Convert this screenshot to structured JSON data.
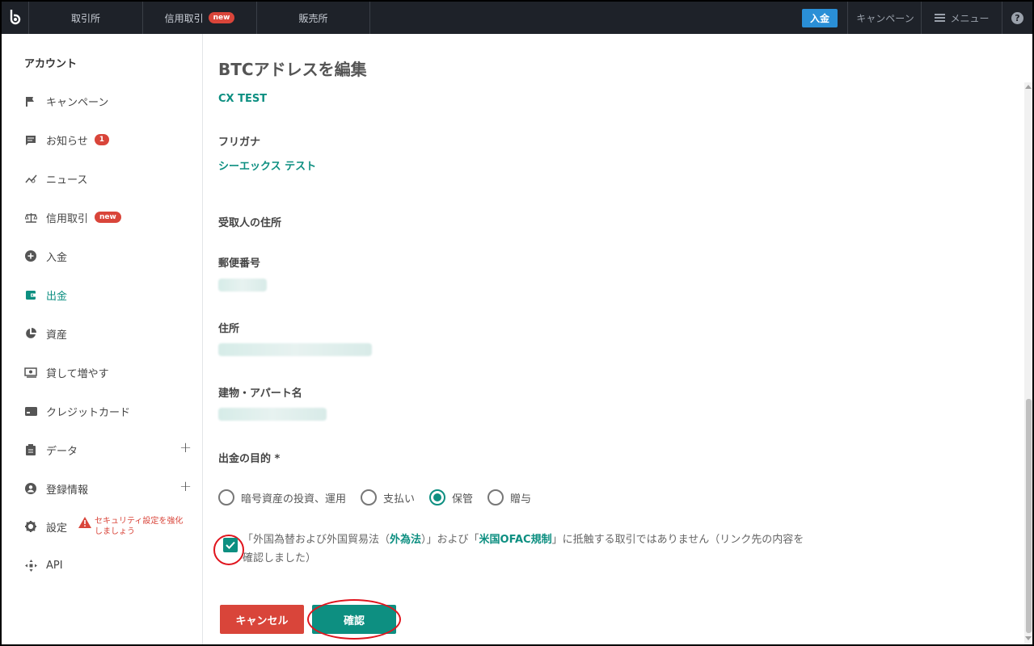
{
  "topbar": {
    "tabs": [
      {
        "label": "取引所"
      },
      {
        "label": "信用取引",
        "badge": "new"
      },
      {
        "label": "販売所"
      }
    ],
    "deposit_label": "入金",
    "campaign_label": "キャンペーン",
    "menu_label": "メニュー",
    "help_label": "?"
  },
  "sidebar": {
    "title": "アカウント",
    "items": [
      {
        "label": "キャンペーン",
        "icon": "flag-icon"
      },
      {
        "label": "お知らせ",
        "icon": "message-icon",
        "count": "1"
      },
      {
        "label": "ニュース",
        "icon": "chart-line-icon"
      },
      {
        "label": "信用取引",
        "icon": "scale-icon",
        "badge": "new"
      },
      {
        "label": "入金",
        "icon": "plus-circle-icon"
      },
      {
        "label": "出金",
        "icon": "wallet-icon",
        "active": true
      },
      {
        "label": "資産",
        "icon": "pie-chart-icon"
      },
      {
        "label": "貸して増やす",
        "icon": "money-icon"
      },
      {
        "label": "クレジットカード",
        "icon": "credit-card-icon"
      },
      {
        "label": "データ",
        "icon": "clipboard-icon"
      },
      {
        "label": "登録情報",
        "icon": "account-icon"
      },
      {
        "label": "設定",
        "icon": "gear-icon"
      },
      {
        "label": "API",
        "icon": "api-icon"
      }
    ],
    "security_warning": "セキュリティ設定を強化しましょう"
  },
  "main": {
    "title": "BTCアドレスを編集",
    "recipient_name": "CX TEST",
    "furigana_label": "フリガナ",
    "furigana_value": "シーエックス テスト",
    "address_section": "受取人の住所",
    "postal_label": "郵便番号",
    "address_label": "住所",
    "building_label": "建物・アパート名",
    "purpose_label": "出金の目的 *",
    "purpose_options": [
      "暗号資産の投資、運用",
      "支払い",
      "保管",
      "贈与"
    ],
    "purpose_selected": "保管",
    "agree_text_1": "「外国為替および外国貿易法（",
    "agree_link_1": "外為法",
    "agree_text_2": "）」および「",
    "agree_link_2": "米国OFAC規制",
    "agree_text_3": "」に抵触する取引ではありません（リンク先の内容を確認しました）",
    "agree_checked": true,
    "cancel_label": "キャンセル",
    "confirm_label": "確認"
  },
  "colors": {
    "accent": "#0d8f81",
    "danger": "#d9453a",
    "topbar_bg": "#1e2229",
    "deposit_blue": "#2a8fd6"
  }
}
